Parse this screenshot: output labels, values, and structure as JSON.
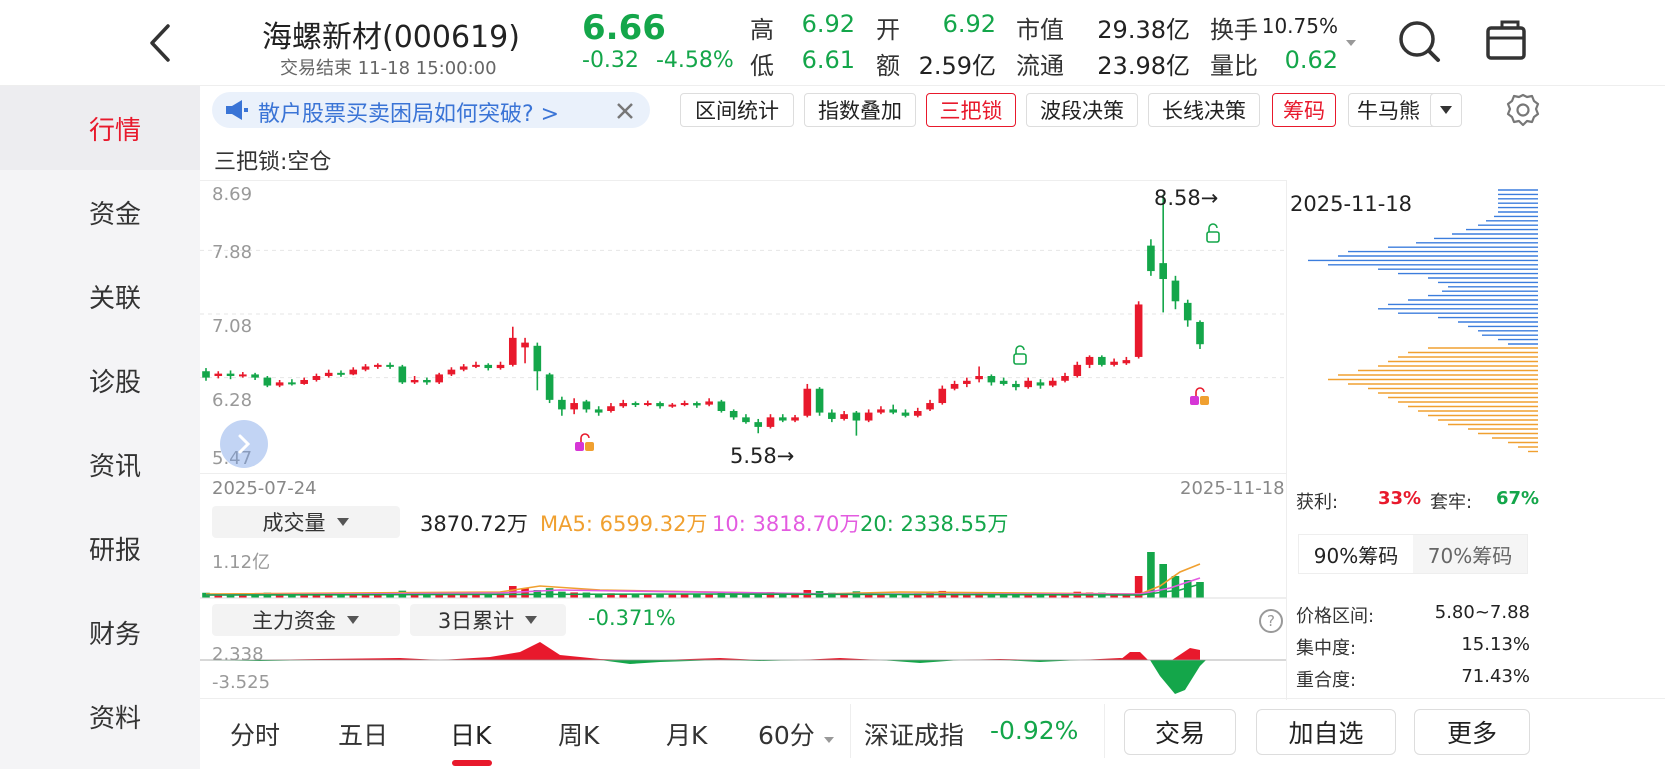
{
  "header": {
    "stock_name": "海螺新材(000619)",
    "trade_status": "交易结束 11-18 15:00:00",
    "price": "6.66",
    "change": "-0.32",
    "change_pct": "-4.58%",
    "stats": {
      "high_label": "高",
      "high": "6.92",
      "low_label": "低",
      "low": "6.61",
      "open_label": "开",
      "open": "6.92",
      "amount_label": "额",
      "amount": "2.59亿",
      "mktcap_label": "市值",
      "mktcap": "29.38亿",
      "float_label": "流通",
      "float": "23.98亿",
      "turnover_label": "换手",
      "turnover": "10.75%",
      "volratio_label": "量比",
      "volratio": "0.62"
    },
    "icons": {
      "back": "chevron-left-icon",
      "search": "search-icon",
      "share": "share-box-icon"
    }
  },
  "sidebar": {
    "items": [
      {
        "label": "行情",
        "active": true
      },
      {
        "label": "资金",
        "active": false
      },
      {
        "label": "关联",
        "active": false
      },
      {
        "label": "诊股",
        "active": false
      },
      {
        "label": "资讯",
        "active": false
      },
      {
        "label": "研报",
        "active": false
      },
      {
        "label": "财务",
        "active": false
      },
      {
        "label": "资料",
        "active": false
      }
    ]
  },
  "toolbar": {
    "promo_text": "散户股票买卖困局如何突破? >",
    "buttons": [
      "区间统计",
      "指数叠加",
      "三把锁",
      "波段决策",
      "长线决策",
      "筹码",
      "牛马熊"
    ],
    "indicator_status": "三把锁:空仓"
  },
  "kline": {
    "y_labels": [
      "8.69",
      "7.88",
      "7.08",
      "6.28",
      "5.47"
    ],
    "start_date": "2025-07-24",
    "end_date": "2025-11-18",
    "high_marker": "8.58→",
    "low_marker": "5.58→",
    "candles": [
      [
        6.36,
        6.28,
        6.4,
        6.24
      ],
      [
        6.3,
        6.33,
        6.36,
        6.27
      ],
      [
        6.33,
        6.3,
        6.37,
        6.26
      ],
      [
        6.3,
        6.32,
        6.35,
        6.28
      ],
      [
        6.32,
        6.28,
        6.34,
        6.25
      ],
      [
        6.28,
        6.18,
        6.3,
        6.16
      ],
      [
        6.18,
        6.22,
        6.25,
        6.16
      ],
      [
        6.22,
        6.2,
        6.26,
        6.18
      ],
      [
        6.2,
        6.25,
        6.28,
        6.19
      ],
      [
        6.25,
        6.3,
        6.33,
        6.23
      ],
      [
        6.3,
        6.34,
        6.38,
        6.28
      ],
      [
        6.34,
        6.32,
        6.37,
        6.29
      ],
      [
        6.32,
        6.38,
        6.41,
        6.31
      ],
      [
        6.38,
        6.42,
        6.45,
        6.36
      ],
      [
        6.42,
        6.44,
        6.46,
        6.39
      ],
      [
        6.44,
        6.42,
        6.47,
        6.39
      ],
      [
        6.42,
        6.22,
        6.44,
        6.2
      ],
      [
        6.22,
        6.25,
        6.3,
        6.2
      ],
      [
        6.25,
        6.22,
        6.28,
        6.19
      ],
      [
        6.22,
        6.32,
        6.34,
        6.2
      ],
      [
        6.32,
        6.38,
        6.41,
        6.3
      ],
      [
        6.38,
        6.42,
        6.45,
        6.36
      ],
      [
        6.42,
        6.44,
        6.48,
        6.4
      ],
      [
        6.44,
        6.4,
        6.46,
        6.37
      ],
      [
        6.4,
        6.44,
        6.48,
        6.38
      ],
      [
        6.44,
        6.78,
        6.92,
        6.42
      ],
      [
        6.66,
        6.72,
        6.78,
        6.46
      ],
      [
        6.68,
        6.36,
        6.72,
        6.12
      ],
      [
        6.32,
        6.0,
        6.34,
        5.96
      ],
      [
        6.0,
        5.88,
        6.04,
        5.8
      ],
      [
        5.88,
        5.96,
        6.02,
        5.82
      ],
      [
        5.98,
        5.88,
        6.0,
        5.84
      ],
      [
        5.88,
        5.84,
        5.92,
        5.8
      ],
      [
        5.86,
        5.92,
        5.96,
        5.84
      ],
      [
        5.92,
        5.96,
        6.0,
        5.9
      ],
      [
        5.96,
        5.94,
        5.98,
        5.91
      ],
      [
        5.94,
        5.96,
        5.99,
        5.92
      ],
      [
        5.96,
        5.92,
        5.98,
        5.89
      ],
      [
        5.92,
        5.94,
        5.96,
        5.9
      ],
      [
        5.94,
        5.96,
        5.99,
        5.92
      ],
      [
        5.96,
        5.93,
        5.98,
        5.9
      ],
      [
        5.94,
        5.98,
        6.02,
        5.92
      ],
      [
        5.98,
        5.86,
        6.0,
        5.84
      ],
      [
        5.86,
        5.78,
        5.88,
        5.75
      ],
      [
        5.78,
        5.72,
        5.82,
        5.7
      ],
      [
        5.72,
        5.66,
        5.76,
        5.58
      ],
      [
        5.66,
        5.78,
        5.82,
        5.64
      ],
      [
        5.78,
        5.74,
        5.82,
        5.72
      ],
      [
        5.74,
        5.78,
        5.81,
        5.72
      ],
      [
        5.8,
        6.14,
        6.2,
        5.78
      ],
      [
        6.14,
        5.84,
        6.16,
        5.8
      ],
      [
        5.84,
        5.76,
        5.88,
        5.72
      ],
      [
        5.76,
        5.82,
        5.86,
        5.74
      ],
      [
        5.84,
        5.74,
        5.86,
        5.55
      ],
      [
        5.74,
        5.84,
        5.88,
        5.72
      ],
      [
        5.84,
        5.88,
        5.92,
        5.82
      ],
      [
        5.88,
        5.84,
        5.94,
        5.82
      ],
      [
        5.84,
        5.8,
        5.88,
        5.78
      ],
      [
        5.8,
        5.86,
        5.9,
        5.78
      ],
      [
        5.88,
        5.96,
        6.0,
        5.86
      ],
      [
        5.96,
        6.14,
        6.18,
        5.94
      ],
      [
        6.14,
        6.2,
        6.24,
        6.12
      ],
      [
        6.2,
        6.24,
        6.28,
        6.16
      ],
      [
        6.26,
        6.3,
        6.42,
        6.22
      ],
      [
        6.3,
        6.22,
        6.32,
        6.18
      ],
      [
        6.24,
        6.2,
        6.28,
        6.18
      ],
      [
        6.2,
        6.16,
        6.24,
        6.12
      ],
      [
        6.16,
        6.24,
        6.28,
        6.14
      ],
      [
        6.22,
        6.18,
        6.26,
        6.14
      ],
      [
        6.18,
        6.24,
        6.28,
        6.16
      ],
      [
        6.24,
        6.3,
        6.34,
        6.22
      ],
      [
        6.3,
        6.44,
        6.48,
        6.28
      ],
      [
        6.44,
        6.54,
        6.56,
        6.4
      ],
      [
        6.54,
        6.44,
        6.56,
        6.42
      ],
      [
        6.44,
        6.48,
        6.52,
        6.42
      ],
      [
        6.46,
        6.5,
        6.54,
        6.44
      ],
      [
        6.54,
        7.2,
        7.24,
        6.52
      ],
      [
        7.94,
        7.62,
        8.02,
        7.56
      ],
      [
        7.72,
        7.52,
        8.58,
        7.1
      ],
      [
        7.5,
        7.24,
        7.56,
        7.14
      ],
      [
        7.22,
        7.0,
        7.26,
        6.92
      ],
      [
        6.98,
        6.7,
        7.0,
        6.64
      ]
    ],
    "lock_icons": [
      "unlock-icon",
      "unlock-icon",
      "lock-icon",
      "lock-icon"
    ]
  },
  "chips": {
    "date": "2025-11-18",
    "profit_label": "获利:",
    "profit": "33%",
    "trapped_label": "套牢:",
    "trapped": "67%",
    "tab_90": "90%筹码",
    "tab_70": "70%筹码",
    "price_range_label": "价格区间:",
    "price_range": "5.80~7.88",
    "concentration_label": "集中度:",
    "concentration": "15.13%",
    "overlap_label": "重合度:",
    "overlap": "71.43%",
    "colors": {
      "above": "#3b7ddd",
      "below": "#f0a030"
    }
  },
  "volume": {
    "selector": "成交量",
    "current": "3870.72万",
    "ma5": "MA5: 6599.32万",
    "ma10": "10: 3818.70万",
    "ma20": "20: 2338.55万",
    "max_label": "1.12亿",
    "colors": {
      "ma5": "#f0a030",
      "ma10": "#e35be0",
      "ma20": "#14a64a"
    }
  },
  "fund_flow": {
    "selector": "主力资金",
    "period": "3日累计",
    "value": "-0.371%",
    "max_label": "2.338",
    "min_label": "-3.525",
    "help_icon": "question-circle-icon"
  },
  "bottom_nav": {
    "tabs": [
      "分时",
      "五日",
      "日K",
      "周K",
      "月K",
      "60分"
    ],
    "active": "日K",
    "index_name": "深证成指",
    "index_change": "-0.92%",
    "actions": [
      "交易",
      "加自选",
      "更多"
    ]
  },
  "colors": {
    "up": "#e8192c",
    "down": "#14a64a",
    "accent_blue": "#3a74d6"
  }
}
